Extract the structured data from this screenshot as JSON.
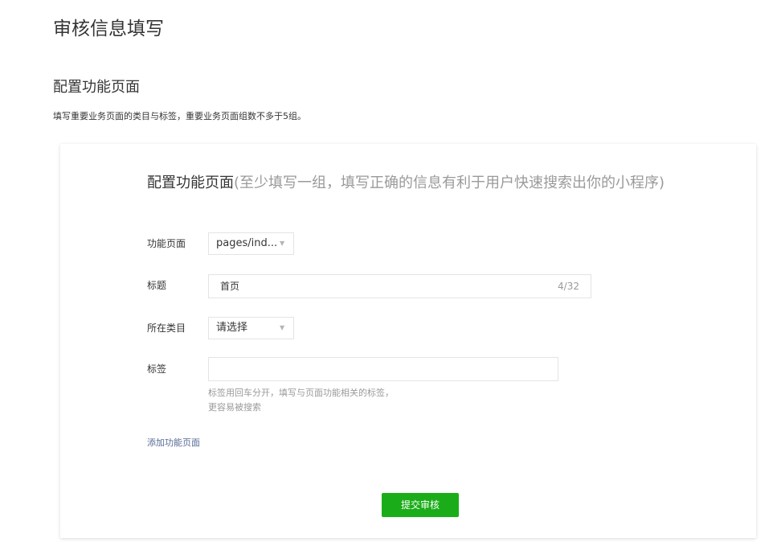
{
  "page": {
    "title": "审核信息填写",
    "section_title": "配置功能页面",
    "section_desc": "填写重要业务页面的类目与标签，重要业务页面组数不多于5组。"
  },
  "card": {
    "title_strong": "配置功能页面",
    "title_hint": "(至少填写一组，填写正确的信息有利于用户快速搜索出你的小程序)"
  },
  "form": {
    "page_label": "功能页面",
    "page_value": "pages/ind...",
    "title_label": "标题",
    "title_value": "首页",
    "title_counter": "4/32",
    "category_label": "所在类目",
    "category_value": "请选择",
    "tags_label": "标签",
    "tags_value": "",
    "tags_hint_line1": "标签用回车分开，填写与页面功能相关的标签，",
    "tags_hint_line2": "更容易被搜索"
  },
  "actions": {
    "add_page": "添加功能页面",
    "submit": "提交审核"
  },
  "colors": {
    "primary": "#1aad19",
    "link": "#576b95"
  }
}
